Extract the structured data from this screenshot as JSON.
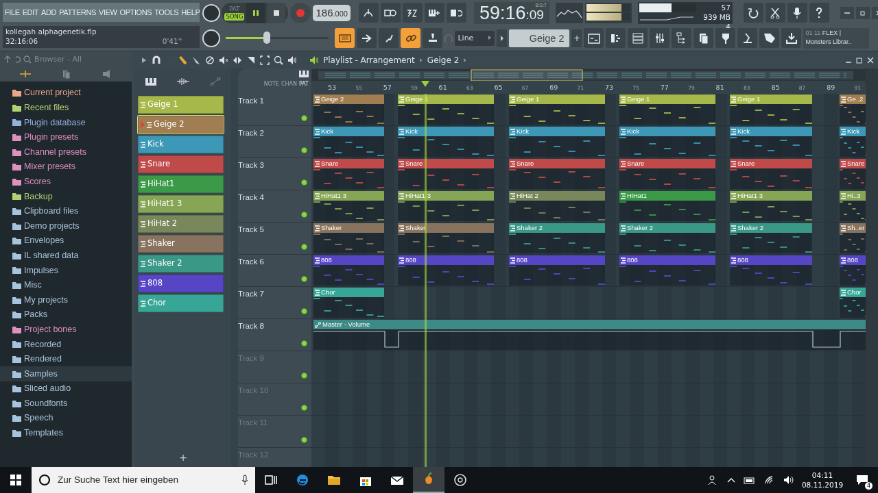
{
  "menu": [
    "FILE",
    "EDIT",
    "ADD",
    "PATTERNS",
    "VIEW",
    "OPTIONS",
    "TOOLS",
    "HELP"
  ],
  "project": {
    "file": "kollegah alphagenetik.flp",
    "position": "32:16:06",
    "duration": "0'41''"
  },
  "transport": {
    "modes": [
      {
        "label": "PAT",
        "selected": false
      },
      {
        "label": "SONG",
        "selected": true
      }
    ],
    "playing": true,
    "tempo": "186",
    "tempo_fraction": ".000"
  },
  "master_volume": {
    "level": 0.4
  },
  "clock": {
    "time": "59:16",
    "ticks": ":09",
    "unit": "B:S:T"
  },
  "output_meter": [
    {
      "level": 0.8
    },
    {
      "level": 0.8
    }
  ],
  "monitor": {
    "cpu": "57",
    "memory": "939 MB",
    "polyphony": "4"
  },
  "cpu_meter": {
    "level": 0.57
  },
  "snap": "Line",
  "pattern_selector": {
    "value": "Geige 2",
    "add": "+"
  },
  "hint": {
    "position": "01 11",
    "title": "FLEX |",
    "text": "Monsters Librar.."
  },
  "browser": {
    "title": "Browser - All",
    "items": [
      {
        "label": "Current project",
        "color": "#e8a68a",
        "selected": false
      },
      {
        "label": "Recent files",
        "color": "#b4d074",
        "selected": false
      },
      {
        "label": "Plugin database",
        "color": "#94b0e0",
        "selected": false
      },
      {
        "label": "Plugin presets",
        "color": "#e090c0",
        "selected": false
      },
      {
        "label": "Channel presets",
        "color": "#e090c0",
        "selected": false
      },
      {
        "label": "Mixer presets",
        "color": "#e090c0",
        "selected": false
      },
      {
        "label": "Scores",
        "color": "#e090c0",
        "selected": false
      },
      {
        "label": "Backup",
        "color": "#b4d074",
        "selected": false
      },
      {
        "label": "Clipboard files",
        "color": "#a8c4dc",
        "selected": false
      },
      {
        "label": "Demo projects",
        "color": "#a8c4dc",
        "selected": false
      },
      {
        "label": "Envelopes",
        "color": "#a8c4dc",
        "selected": false
      },
      {
        "label": "IL shared data",
        "color": "#a8c4dc",
        "selected": false
      },
      {
        "label": "Impulses",
        "color": "#a8c4dc",
        "selected": false
      },
      {
        "label": "Misc",
        "color": "#a8c4dc",
        "selected": false
      },
      {
        "label": "My projects",
        "color": "#a8c4dc",
        "selected": false
      },
      {
        "label": "Packs",
        "color": "#a8c4dc",
        "selected": false
      },
      {
        "label": "Project bones",
        "color": "#e090c0",
        "selected": false
      },
      {
        "label": "Recorded",
        "color": "#a8c4dc",
        "selected": false
      },
      {
        "label": "Rendered",
        "color": "#a8c4dc",
        "selected": false
      },
      {
        "label": "Samples",
        "color": "#a8c4dc",
        "selected": true
      },
      {
        "label": "Sliced audio",
        "color": "#a8c4dc",
        "selected": false
      },
      {
        "label": "Soundfonts",
        "color": "#a8c4dc",
        "selected": false
      },
      {
        "label": "Speech",
        "color": "#a8c4dc",
        "selected": false
      },
      {
        "label": "Templates",
        "color": "#a8c4dc",
        "selected": false
      }
    ]
  },
  "playlist": {
    "title": "Playlist - Arrangement",
    "pattern": "Geige 2",
    "track_tabs": [
      "NOTE",
      "CHAN",
      "PAT"
    ]
  },
  "patterns": [
    {
      "label": "Geige 1",
      "color": "#a6b84a",
      "selected": false
    },
    {
      "label": "Geige 2",
      "color": "#a07e52",
      "selected": true
    },
    {
      "label": "Kick",
      "color": "#3c98b6",
      "selected": false
    },
    {
      "label": "Snare",
      "color": "#c04a4a",
      "selected": false
    },
    {
      "label": "HiHat1",
      "color": "#3a9a48",
      "selected": false
    },
    {
      "label": "HiHat1 3",
      "color": "#86a656",
      "selected": false
    },
    {
      "label": "HiHat 2",
      "color": "#78885a",
      "selected": false
    },
    {
      "label": "Shaker",
      "color": "#88745e",
      "selected": false
    },
    {
      "label": "Shaker 2",
      "color": "#3a9886",
      "selected": false
    },
    {
      "label": "808",
      "color": "#5646c6",
      "selected": false
    },
    {
      "label": "Chor",
      "color": "#38a696",
      "selected": false
    }
  ],
  "add_pattern": "+",
  "ruler": [
    {
      "label": "53",
      "major": true
    },
    {
      "label": "55",
      "major": false
    },
    {
      "label": "57",
      "major": true
    },
    {
      "label": "59",
      "major": false
    },
    {
      "label": "61",
      "major": true
    },
    {
      "label": "63",
      "major": false
    },
    {
      "label": "65",
      "major": true
    },
    {
      "label": "67",
      "major": false
    },
    {
      "label": "69",
      "major": true
    },
    {
      "label": "71",
      "major": false
    },
    {
      "label": "73",
      "major": true
    },
    {
      "label": "75",
      "major": false
    },
    {
      "label": "77",
      "major": true
    },
    {
      "label": "79",
      "major": false
    },
    {
      "label": "81",
      "major": true
    },
    {
      "label": "83",
      "major": false
    },
    {
      "label": "85",
      "major": true
    },
    {
      "label": "87",
      "major": false
    },
    {
      "label": "89",
      "major": true
    },
    {
      "label": "91",
      "major": false
    }
  ],
  "tracks": [
    {
      "name": "Track 1",
      "enabled": true,
      "clips": [
        {
          "label": "Geige 2",
          "color": "#a07e52"
        },
        {
          "label": "Geige 1",
          "color": "#a6b84a"
        },
        {
          "label": "Geige 1",
          "color": "#a6b84a"
        },
        {
          "label": "Geige 1",
          "color": "#a6b84a"
        },
        {
          "label": "Geige 1",
          "color": "#a6b84a"
        },
        {
          "label": "Ge..2",
          "color": "#a07e52"
        }
      ]
    },
    {
      "name": "Track 2",
      "enabled": true,
      "clips": [
        {
          "label": "Kick",
          "color": "#3c98b6"
        },
        {
          "label": "Kick",
          "color": "#3c98b6"
        },
        {
          "label": "Kick",
          "color": "#3c98b6"
        },
        {
          "label": "Kick",
          "color": "#3c98b6"
        },
        {
          "label": "Kick",
          "color": "#3c98b6"
        },
        {
          "label": "Kick",
          "color": "#3c98b6"
        }
      ]
    },
    {
      "name": "Track 3",
      "enabled": true,
      "clips": [
        {
          "label": "Snare",
          "color": "#c04a4a"
        },
        {
          "label": "Snare",
          "color": "#c04a4a"
        },
        {
          "label": "Snare",
          "color": "#c04a4a"
        },
        {
          "label": "Snare",
          "color": "#c04a4a"
        },
        {
          "label": "Snare",
          "color": "#c04a4a"
        },
        {
          "label": "Snare",
          "color": "#c04a4a"
        }
      ]
    },
    {
      "name": "Track 4",
      "enabled": true,
      "clips": [
        {
          "label": "HiHat1 3",
          "color": "#86a656"
        },
        {
          "label": "HiHat1 3",
          "color": "#86a656"
        },
        {
          "label": "HiHat 2",
          "color": "#78885a"
        },
        {
          "label": "HiHat1",
          "color": "#3a9a48"
        },
        {
          "label": "HiHat1 3",
          "color": "#86a656"
        },
        {
          "label": "Hi..3",
          "color": "#86a656"
        }
      ]
    },
    {
      "name": "Track 5",
      "enabled": true,
      "clips": [
        {
          "label": "Shaker",
          "color": "#88745e"
        },
        {
          "label": "Shaker",
          "color": "#88745e"
        },
        {
          "label": "Shaker 2",
          "color": "#3a9886"
        },
        {
          "label": "Shaker 2",
          "color": "#3a9886"
        },
        {
          "label": "Shaker 2",
          "color": "#3a9886"
        },
        {
          "label": "Sh..er",
          "color": "#88745e"
        }
      ]
    },
    {
      "name": "Track 6",
      "enabled": true,
      "clips": [
        {
          "label": "808",
          "color": "#5646c6"
        },
        {
          "label": "808",
          "color": "#5646c6"
        },
        {
          "label": "808",
          "color": "#5646c6"
        },
        {
          "label": "808",
          "color": "#5646c6"
        },
        {
          "label": "808",
          "color": "#5646c6"
        },
        {
          "label": "808",
          "color": "#5646c6"
        }
      ]
    },
    {
      "name": "Track 7",
      "enabled": true,
      "clips": [
        {
          "label": "Chor",
          "color": "#38a696"
        },
        {
          "kind": "gap"
        },
        {
          "kind": "gap"
        },
        {
          "kind": "gap"
        },
        {
          "kind": "gap"
        },
        {
          "label": "Chor",
          "color": "#38a696"
        }
      ]
    },
    {
      "name": "Track 8",
      "enabled": true,
      "automation": {
        "label": "Master - Volume",
        "color": "#3d8a86"
      }
    },
    {
      "name": "Track 9",
      "enabled": true
    },
    {
      "name": "Track 10",
      "enabled": true
    },
    {
      "name": "Track 11",
      "enabled": true
    },
    {
      "name": "Track 12"
    }
  ],
  "taskbar": {
    "search_placeholder": "Zur Suche Text hier eingeben",
    "time": "04:11",
    "date": "08.11.2019",
    "notifications": "4"
  }
}
